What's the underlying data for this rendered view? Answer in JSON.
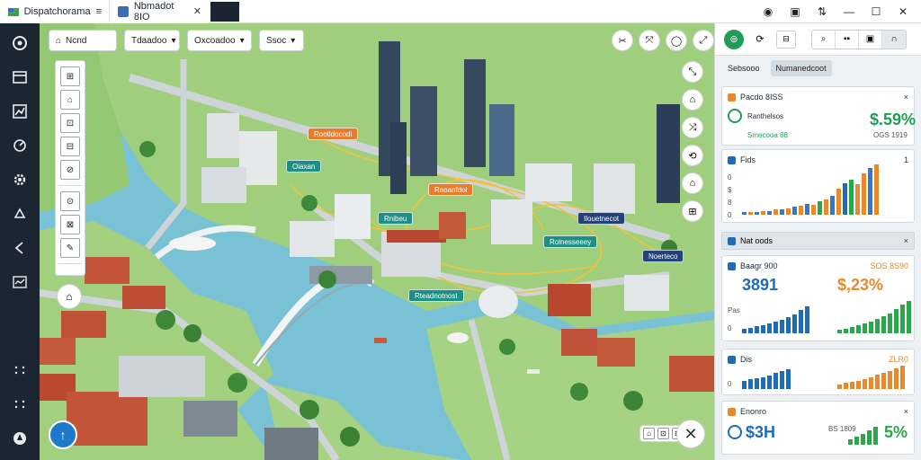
{
  "titlebar": {
    "tab1_title": "Dispatchorama",
    "tab1_menu": "≡",
    "tab2_title": "Nbmadot 8IO",
    "tab2_close": "✕",
    "controls": [
      "◉",
      "▣",
      "⇅",
      "—",
      "☐",
      "✕"
    ]
  },
  "rail": {
    "items": [
      "home-circle",
      "window",
      "chart",
      "settings-dial",
      "gear",
      "cloud",
      "tag",
      "pulse",
      "dots-a",
      "dots-b",
      "globe"
    ]
  },
  "map": {
    "toolbar": [
      {
        "label": "Ncnd",
        "icon": "⌂"
      },
      {
        "label": "Tdaadoo",
        "icon": "▾"
      },
      {
        "label": "Oxcoadoo",
        "icon": "▾"
      },
      {
        "label": "Ssoc",
        "icon": "▾"
      }
    ],
    "actions": [
      "✂",
      "⤧",
      "◯",
      "⤢"
    ],
    "tools": [
      "⊞",
      "⌂",
      "⊡",
      "⊟",
      "⊘",
      "⊙",
      "⊠",
      "✎"
    ],
    "tool_solo": "⌂",
    "right_tools": [
      "⤡",
      "⌂",
      "⤨",
      "⟲",
      "⌂",
      "⊞"
    ],
    "pois": [
      {
        "text": "Rootldocodi",
        "style": "orange"
      },
      {
        "text": "Oiaxan",
        "style": "teal"
      },
      {
        "text": "Rnibeu",
        "style": "teal"
      },
      {
        "text": "Raoanfdol",
        "style": "orange"
      },
      {
        "text": "Ilouetnecot",
        "style": "navy"
      },
      {
        "text": "Rolnesseeey",
        "style": "teal"
      },
      {
        "text": "Rteadnotnost",
        "style": "teal"
      },
      {
        "text": "Noerteco",
        "style": "navy"
      }
    ],
    "compass": "↑",
    "bottom_ctrls": [
      "⌂",
      "⊡",
      "⊞"
    ],
    "close_icon": "✕"
  },
  "panel": {
    "top_icons": [
      "⊚",
      "⟳",
      "⊟"
    ],
    "top_group": [
      "⌕",
      "▪▪",
      "▣",
      "∩"
    ],
    "tabs": [
      "Sebsooo",
      "Numanedcoot"
    ],
    "card1": {
      "title": "Pacdo 8ISS",
      "subtitle": "Ranthelsos",
      "caption": "Smecooa 88",
      "right_caption": "OGS 1919",
      "value": "$.59%",
      "close": "×",
      "dot": "#e8892c",
      "value_color": "#1f9d55"
    },
    "card2": {
      "title": "Fids",
      "row_labels": [
        "0",
        "$",
        "8",
        "0"
      ],
      "tick": "1",
      "bars": [
        {
          "v": 0.06,
          "c": "#3478c8"
        },
        {
          "v": 0.05,
          "c": "#e8892c"
        },
        {
          "v": 0.06,
          "c": "#3478c8"
        },
        {
          "v": 0.07,
          "c": "#e8892c"
        },
        {
          "v": 0.08,
          "c": "#3478c8"
        },
        {
          "v": 0.1,
          "c": "#e8892c"
        },
        {
          "v": 0.11,
          "c": "#3478c8"
        },
        {
          "v": 0.13,
          "c": "#e8892c"
        },
        {
          "v": 0.16,
          "c": "#3478c8"
        },
        {
          "v": 0.18,
          "c": "#e8892c"
        },
        {
          "v": 0.22,
          "c": "#3478c8"
        },
        {
          "v": 0.2,
          "c": "#e8892c"
        },
        {
          "v": 0.26,
          "c": "#2ba64a"
        },
        {
          "v": 0.3,
          "c": "#e8892c"
        },
        {
          "v": 0.37,
          "c": "#3478c8"
        },
        {
          "v": 0.52,
          "c": "#e8892c"
        },
        {
          "v": 0.62,
          "c": "#1e6bb8"
        },
        {
          "v": 0.7,
          "c": "#2ba64a"
        },
        {
          "v": 0.6,
          "c": "#e8892c"
        },
        {
          "v": 0.82,
          "c": "#e8892c"
        },
        {
          "v": 0.92,
          "c": "#3478c8"
        },
        {
          "v": 1.0,
          "c": "#e8892c"
        }
      ]
    },
    "section": {
      "title": "Nat oods",
      "close": "×"
    },
    "card3": {
      "title": "Baagr 900",
      "right_caption": "SOS 8S90",
      "value_left": "3891",
      "value_right": "$,23%",
      "left_color": "#1e6bb8",
      "right_color": "#e8892c",
      "row_label": "0",
      "caption": "Pas",
      "bars_left": [
        0.15,
        0.2,
        0.25,
        0.3,
        0.35,
        0.42,
        0.5,
        0.6,
        0.7,
        0.85,
        1.0
      ],
      "bars_right": [
        0.1,
        0.15,
        0.2,
        0.25,
        0.3,
        0.36,
        0.44,
        0.52,
        0.62,
        0.75,
        0.88,
        1.0
      ]
    },
    "card4": {
      "title": "Dis",
      "right_caption": "ZLR0",
      "row_label": "0",
      "bars_left": [
        0.4,
        0.5,
        0.55,
        0.6,
        0.7,
        0.8,
        0.9,
        1.0
      ],
      "bars_right": [
        0.2,
        0.25,
        0.3,
        0.36,
        0.42,
        0.5,
        0.6,
        0.68,
        0.78,
        0.88,
        1.0
      ]
    },
    "card5": {
      "title": "Enonro",
      "close": "×",
      "value_left": "$3H",
      "value_right": "5%",
      "caption_right": "BS 1809",
      "bars_right": [
        0.3,
        0.45,
        0.6,
        0.8,
        1.0
      ]
    }
  }
}
